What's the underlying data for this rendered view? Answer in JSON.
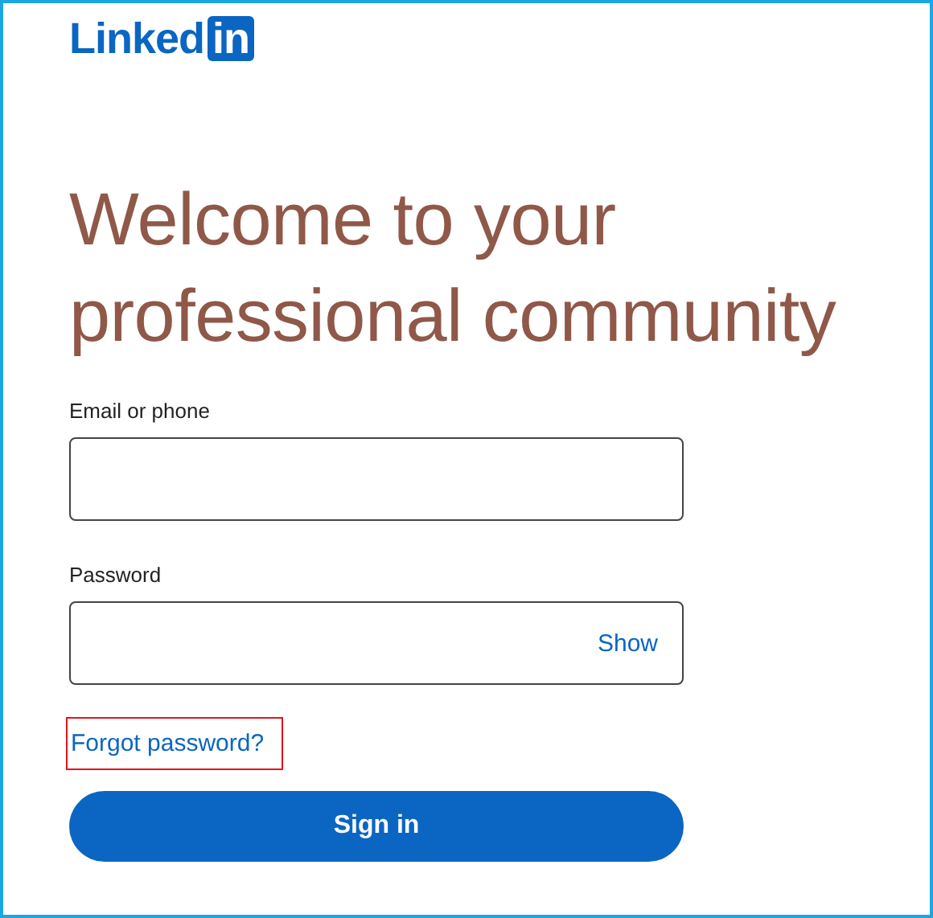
{
  "logo": {
    "word": "Linked",
    "badge": "in"
  },
  "heading": [
    "Welcome to your",
    "professional community"
  ],
  "fields": [
    {
      "label": "Email or phone"
    },
    {
      "label": "Password",
      "action": "Show"
    }
  ],
  "forgot_link": {
    "text": "Forgot password?",
    "highlighted": true
  },
  "sign_in_button": "Sign in"
}
